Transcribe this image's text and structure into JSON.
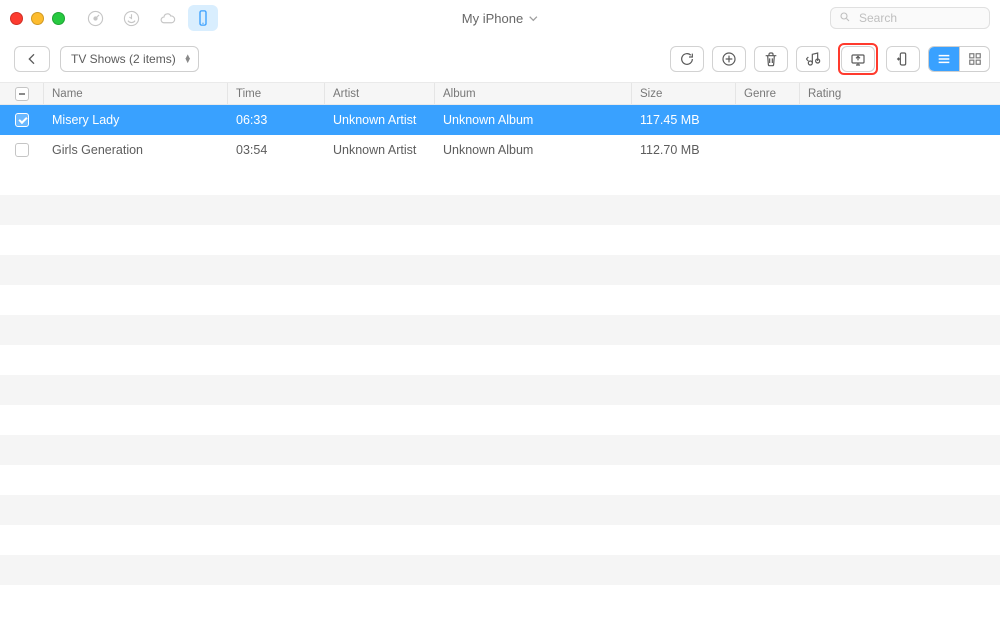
{
  "header": {
    "device_title": "My iPhone",
    "search_placeholder": "Search"
  },
  "toolbar": {
    "category_label": "TV Shows (2 items)"
  },
  "columns": {
    "name": "Name",
    "time": "Time",
    "artist": "Artist",
    "album": "Album",
    "size": "Size",
    "genre": "Genre",
    "rating": "Rating"
  },
  "rows": [
    {
      "selected": true,
      "name": "Misery Lady",
      "time": "06:33",
      "artist": "Unknown Artist",
      "album": "Unknown Album",
      "size": "117.45 MB",
      "genre": "",
      "rating": ""
    },
    {
      "selected": false,
      "name": "Girls Generation",
      "time": "03:54",
      "artist": "Unknown Artist",
      "album": "Unknown Album",
      "size": "112.70 MB",
      "genre": "",
      "rating": ""
    }
  ]
}
